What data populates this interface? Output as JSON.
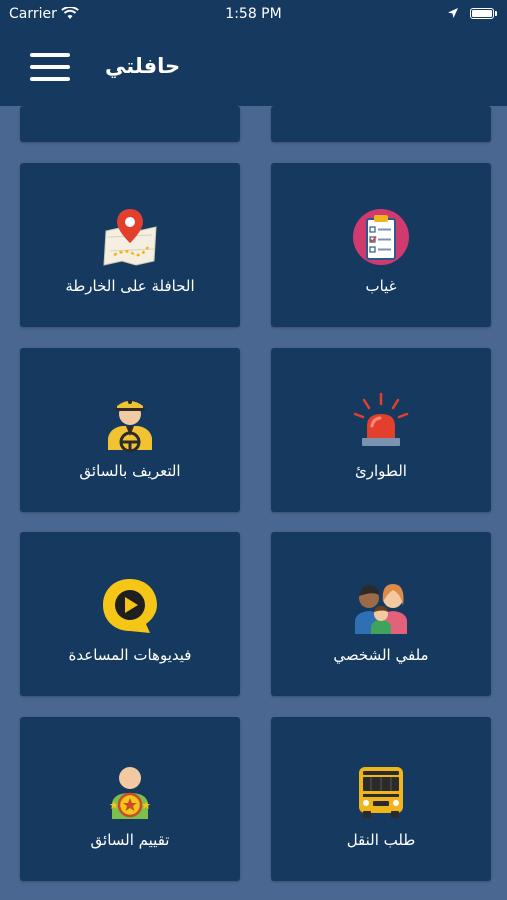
{
  "status_bar": {
    "carrier": "Carrier",
    "time": "1:58 PM"
  },
  "nav": {
    "title": "حافلتي",
    "menu_icon": "hamburger-icon"
  },
  "tiles": [
    {
      "label": "",
      "icon": "partial-tile"
    },
    {
      "label": "",
      "icon": "partial-tile"
    },
    {
      "label": "الحافلة على الخارطة",
      "icon": "map-pin-icon"
    },
    {
      "label": "غياب",
      "icon": "checklist-icon"
    },
    {
      "label": "التعريف بالسائق",
      "icon": "driver-icon"
    },
    {
      "label": "الطوارئ",
      "icon": "siren-icon"
    },
    {
      "label": "فيديوهات المساعدة",
      "icon": "play-video-icon"
    },
    {
      "label": "ملفي الشخصي",
      "icon": "family-icon"
    },
    {
      "label": "تقييم السائق",
      "icon": "rating-icon"
    },
    {
      "label": "طلب النقل",
      "icon": "bus-icon"
    }
  ],
  "colors": {
    "background": "#4a6791",
    "tile": "#163a5f",
    "header": "#163a5f",
    "accent_yellow": "#f5c518"
  }
}
